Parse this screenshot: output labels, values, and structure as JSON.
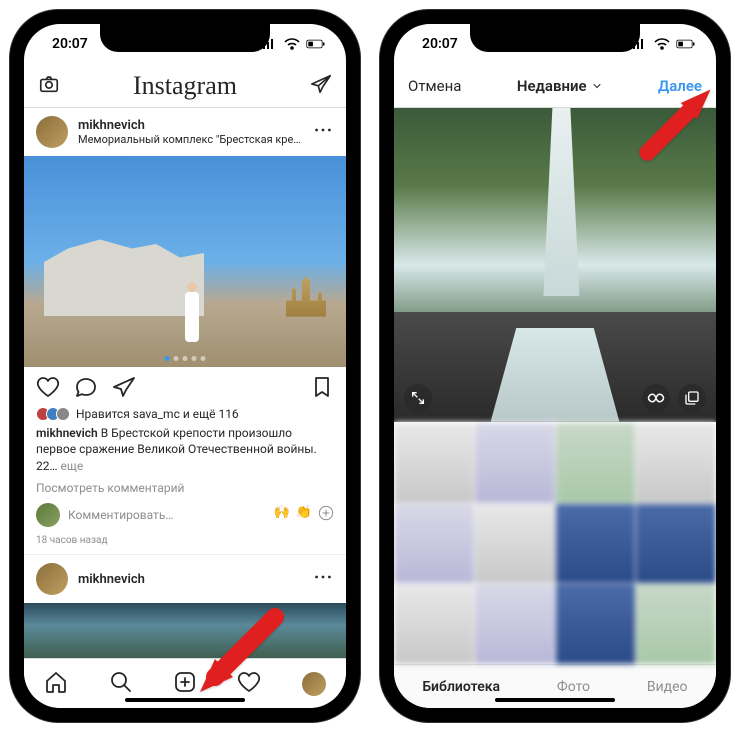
{
  "status": {
    "time": "20:07"
  },
  "left": {
    "header": {
      "title": "Instagram"
    },
    "post": {
      "username": "mikhnevich",
      "location": "Мемориальный комплекс \"Брестская крепость-ге…",
      "likes_text": "Нравится sava_mc и ещё 116",
      "caption_user": "mikhnevich",
      "caption_text": " В Брестской крепости произошло первое сражение Великой Отечественной войны. 22… ",
      "more": "еще",
      "view_comments": "Посмотреть комментарий",
      "comment_placeholder": "Комментировать…",
      "timestamp": "18 часов назад"
    },
    "next_post_username": "mikhnevich"
  },
  "right": {
    "header": {
      "cancel": "Отмена",
      "title": "Недавние",
      "next": "Далее"
    },
    "tabs": {
      "library": "Библиотека",
      "photo": "Фото",
      "video": "Видео"
    }
  },
  "icons": {
    "camera": "camera-icon",
    "dm": "direct-message-icon",
    "more": "more-icon",
    "heart": "heart-icon",
    "comment": "comment-icon",
    "share": "share-icon",
    "bookmark": "bookmark-icon",
    "home": "home-icon",
    "search": "search-icon",
    "add": "add-post-icon",
    "activity": "activity-icon",
    "expand": "expand-icon",
    "infinity": "boomerang-icon",
    "multi": "multi-select-icon",
    "chevron": "chevron-down-icon",
    "plus-circle": "plus-circle-icon"
  },
  "emojis": [
    "🙌",
    "👏"
  ]
}
